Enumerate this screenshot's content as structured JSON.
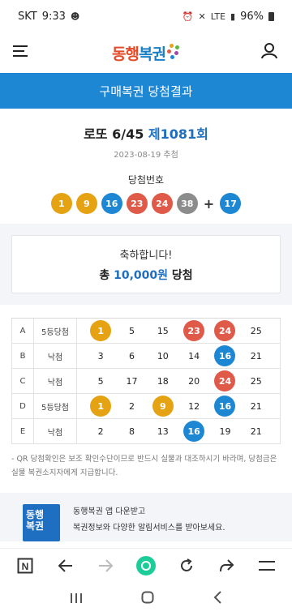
{
  "status_bar": {
    "carrier": "SKT",
    "time": "9:33",
    "battery": "96%",
    "network": "LTE"
  },
  "header": {
    "logo_main_1": "동행",
    "logo_main_2": "복권",
    "menu_icon": "hamburger-icon",
    "user_icon": "user-icon"
  },
  "title_bar": {
    "title": "구매복권 당첨결과"
  },
  "result": {
    "game": "로또 6/45",
    "round": "제1081회",
    "draw_date": "2023-08-19 추첨",
    "winning_label": "당첨번호",
    "winning_numbers": [
      "1",
      "9",
      "16",
      "23",
      "24",
      "38"
    ],
    "bonus_number": "17",
    "plus": "+"
  },
  "prize": {
    "congrats": "축하합니다!",
    "prefix": "총",
    "amount": "10,000원",
    "suffix": "당첨"
  },
  "ticket": {
    "rows": [
      {
        "label": "A",
        "result": "5등당첨",
        "numbers": [
          "1",
          "5",
          "15",
          "23",
          "24",
          "25"
        ],
        "hits": [
          1,
          0,
          0,
          1,
          1,
          0
        ]
      },
      {
        "label": "B",
        "result": "낙첨",
        "numbers": [
          "3",
          "6",
          "10",
          "14",
          "16",
          "21"
        ],
        "hits": [
          0,
          0,
          0,
          0,
          1,
          0
        ]
      },
      {
        "label": "C",
        "result": "낙첨",
        "numbers": [
          "5",
          "17",
          "18",
          "20",
          "24",
          "25"
        ],
        "hits": [
          0,
          0,
          0,
          0,
          1,
          0
        ]
      },
      {
        "label": "D",
        "result": "5등당첨",
        "numbers": [
          "1",
          "2",
          "9",
          "12",
          "16",
          "21"
        ],
        "hits": [
          1,
          0,
          1,
          0,
          1,
          0
        ]
      },
      {
        "label": "E",
        "result": "낙첨",
        "numbers": [
          "2",
          "8",
          "13",
          "16",
          "19",
          "21"
        ],
        "hits": [
          0,
          0,
          0,
          1,
          0,
          0
        ]
      }
    ]
  },
  "notice": "- QR 당첨확인은 보조 확인수단이므로 반드시 실물과 대조하시기 바라며, 당첨금은 실물 복권소지자에게 지급합니다.",
  "app_promo": {
    "icon_text_1": "동행",
    "icon_text_2": "복권",
    "line1": "동행복권 앱 다운받고",
    "line2": "복권정보와 다양한 알림서비스를 받아보세요."
  },
  "ball_colors": {
    "1-10": "#e5a314",
    "11-20": "#1e87d4",
    "21-30": "#e05a4a",
    "31-40": "#8c8c8c",
    "41-45": "#5fb541"
  },
  "browser_nav": {
    "items": [
      "tab-icon",
      "back-icon",
      "forward-icon",
      "home-icon",
      "refresh-icon",
      "share-icon",
      "menu-icon"
    ]
  },
  "system_nav": {
    "items": [
      "recents-icon",
      "home-button-icon",
      "back-button-icon"
    ]
  }
}
